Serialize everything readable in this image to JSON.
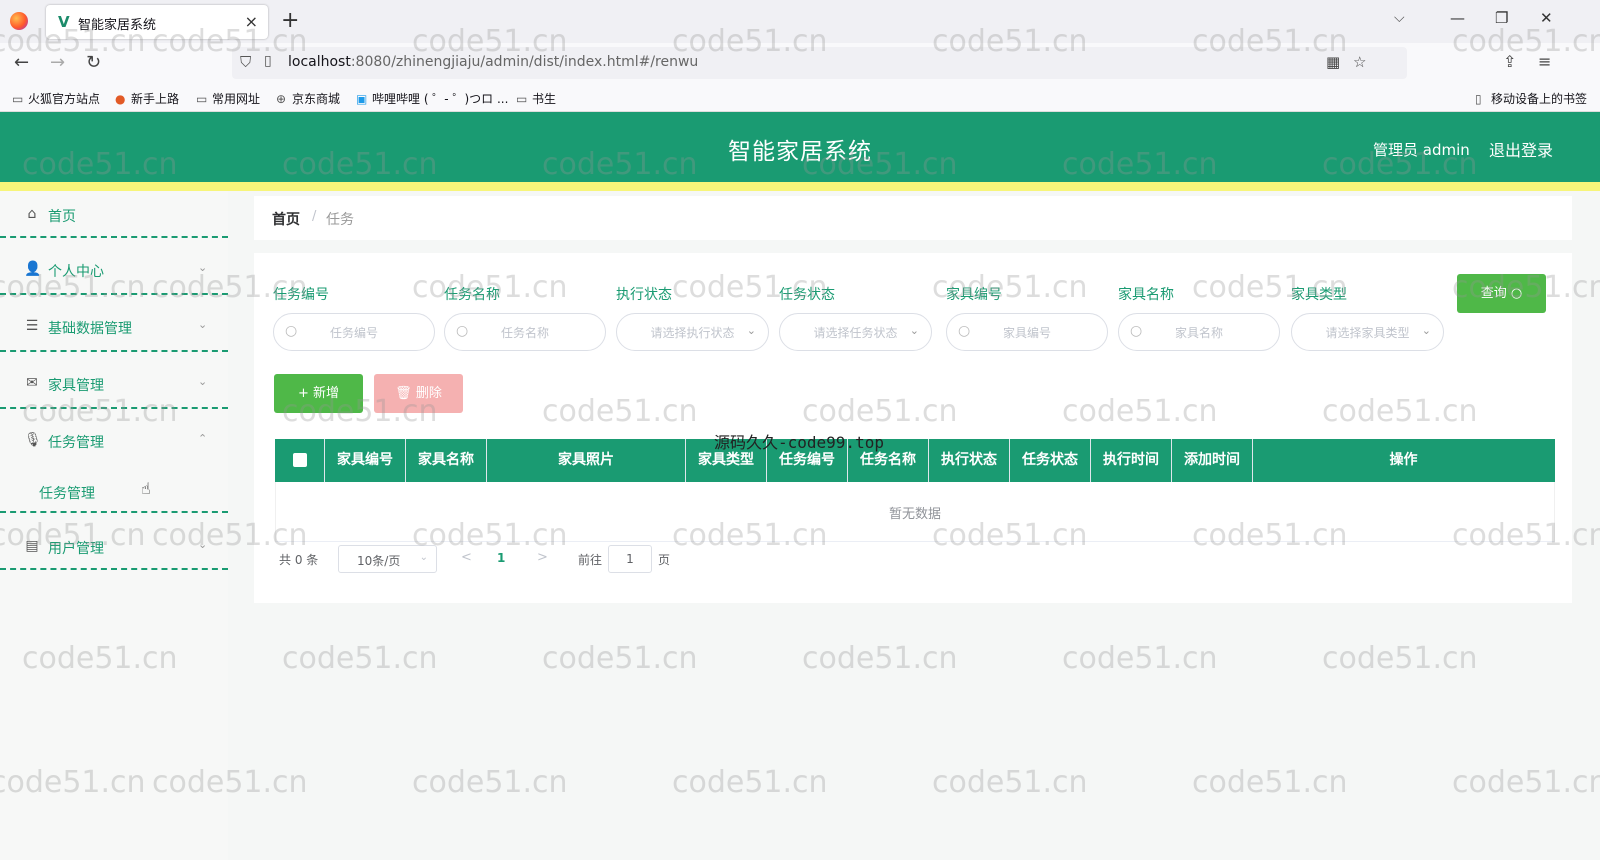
{
  "browser": {
    "tab_title": "智能家居系统",
    "tab_close": "×",
    "new_tab": "+",
    "url_host": "localhost",
    "url_path": ":8080/zhinengjiaju/admin/dist/index.html#/renwu",
    "bookmarks": [
      "火狐官方站点",
      "新手上路",
      "常用网址",
      "京东商城",
      "哔哩哔哩 ( ゜- ゜)つロ ...",
      "书生"
    ],
    "mobile_bookmarks": "移动设备上的书签"
  },
  "header": {
    "title": "智能家居系统",
    "admin_label": "管理员 admin",
    "logout": "退出登录"
  },
  "sidebar": {
    "items": [
      {
        "label": "首页",
        "icon": "home-icon"
      },
      {
        "label": "个人中心",
        "icon": "user-icon"
      },
      {
        "label": "基础数据管理",
        "icon": "sliders-icon"
      },
      {
        "label": "家具管理",
        "icon": "mail-icon"
      },
      {
        "label": "任务管理",
        "icon": "mic-icon"
      },
      {
        "label": "用户管理",
        "icon": "card-icon"
      }
    ],
    "sub_item": "任务管理"
  },
  "breadcrumb": {
    "home": "首页",
    "separator": "/",
    "current": "任务"
  },
  "filters": {
    "labels": [
      "任务编号",
      "任务名称",
      "执行状态",
      "任务状态",
      "家具编号",
      "家具名称",
      "家具类型"
    ],
    "placeholders": [
      "任务编号",
      "任务名称",
      "请选择执行状态",
      "请选择任务状态",
      "家具编号",
      "家具名称",
      "请选择家具类型"
    ],
    "query_button": "查询"
  },
  "actions": {
    "add": "新增",
    "delete": "删除"
  },
  "table": {
    "columns": [
      "家具编号",
      "家具名称",
      "家具照片",
      "家具类型",
      "任务编号",
      "任务名称",
      "执行状态",
      "任务状态",
      "执行时间",
      "添加时间",
      "操作"
    ],
    "empty_text": "暂无数据"
  },
  "pagination": {
    "total": "共 0 条",
    "page_size": "10条/页",
    "current_page": "1",
    "goto_label": "前往",
    "goto_value": "1",
    "page_unit": "页"
  },
  "watermark": "code51.cn",
  "source_mark": "源码久久-code99.top",
  "colors": {
    "primary": "#1a9b72",
    "stripe": "#f7f57a",
    "button_green": "#4fb848",
    "button_disabled_red": "#f5b1b1"
  }
}
